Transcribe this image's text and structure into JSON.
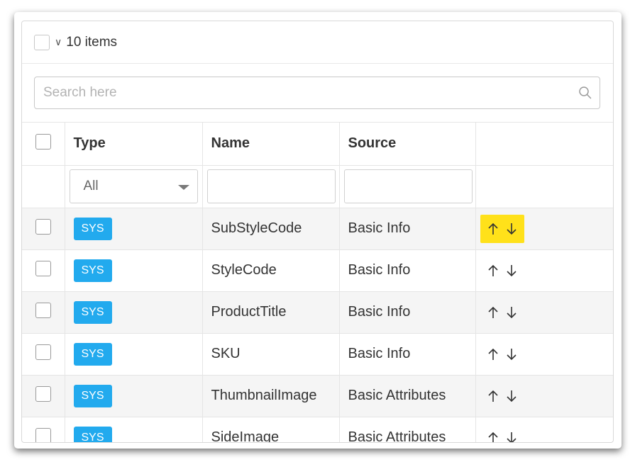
{
  "header": {
    "count_label": "10 items"
  },
  "search": {
    "placeholder": "Search here"
  },
  "columns": {
    "type": "Type",
    "name": "Name",
    "source": "Source"
  },
  "filters": {
    "type_selected": "All",
    "name_value": "",
    "source_value": ""
  },
  "rows": [
    {
      "type": "SYS",
      "name": "SubStyleCode",
      "source": "Basic Info"
    },
    {
      "type": "SYS",
      "name": "StyleCode",
      "source": "Basic Info"
    },
    {
      "type": "SYS",
      "name": "ProductTitle",
      "source": "Basic Info"
    },
    {
      "type": "SYS",
      "name": "SKU",
      "source": "Basic Info"
    },
    {
      "type": "SYS",
      "name": "ThumbnailImage",
      "source": "Basic Attributes"
    },
    {
      "type": "SYS",
      "name": "SideImage",
      "source": "Basic Attributes"
    }
  ],
  "colors": {
    "badge": "#22aaee",
    "highlight": "#ffe11a"
  },
  "icons": {
    "search": "search-icon",
    "move_up": "arrow-up-icon",
    "move_down": "arrow-down-icon",
    "dropdown": "caret-down-icon",
    "expand": "chevron-down-icon"
  }
}
